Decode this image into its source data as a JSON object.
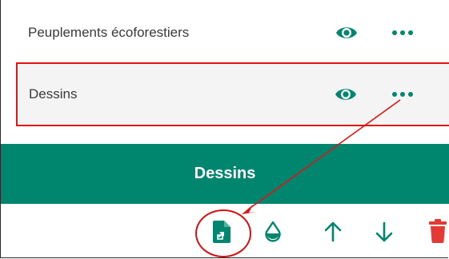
{
  "layers": [
    {
      "label": "Peuplements écoforestiers",
      "visibility_icon": "eye-icon",
      "menu_icon": "more-horizontal-icon"
    },
    {
      "label": "Dessins",
      "visibility_icon": "eye-icon",
      "menu_icon": "more-horizontal-icon"
    }
  ],
  "panel": {
    "title": "Dessins"
  },
  "toolbar": {
    "icons": [
      "export-file-icon",
      "fill-drop-icon",
      "arrow-up-icon",
      "arrow-down-icon",
      "trash-icon"
    ]
  },
  "colors": {
    "accent": "#00856f",
    "highlight": "#e11414",
    "delete": "#e53935",
    "icon": "#00856f"
  }
}
